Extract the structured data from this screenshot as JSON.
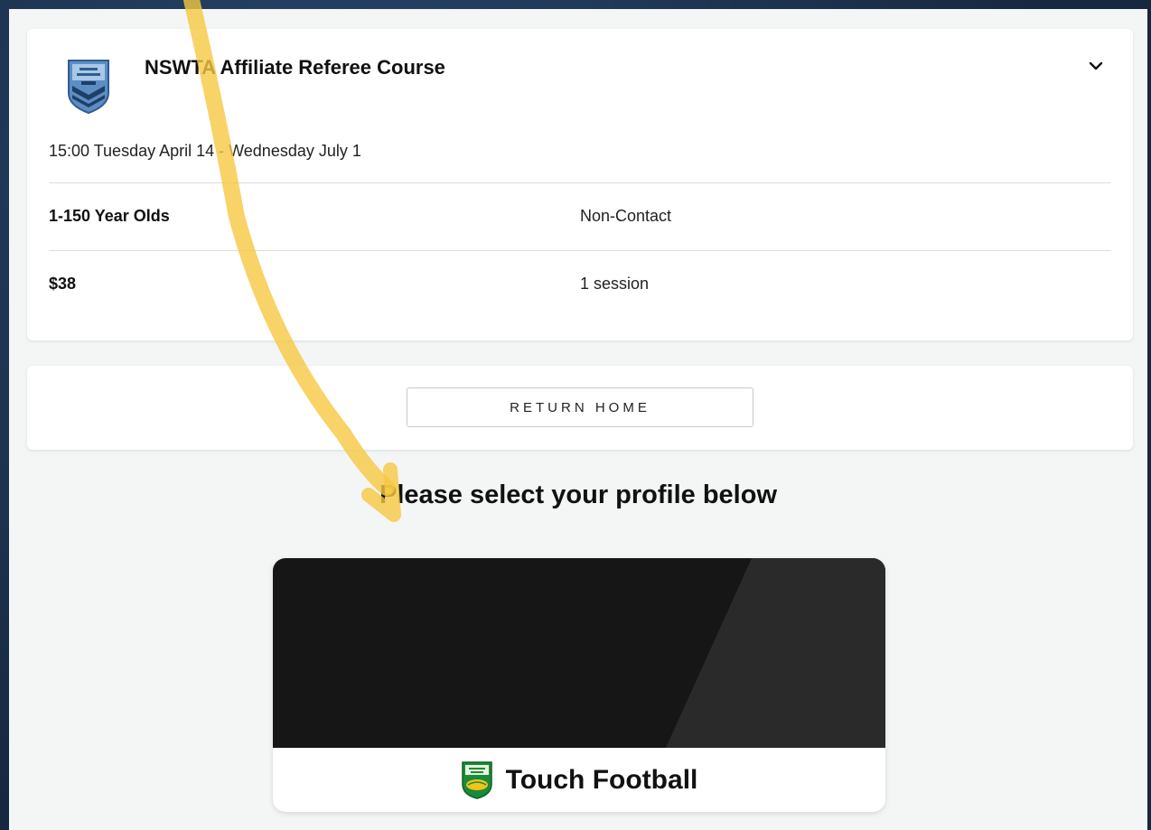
{
  "event": {
    "title": "NSWTA Affiliate Referee Course",
    "logo_icon": "nsw-touch-football-shield-icon",
    "date": "15:00 Tuesday April 14 - Wednesday July 1",
    "age_range": "1-150 Year Olds",
    "contact_type": "Non-Contact",
    "price": "$38",
    "sessions": "1 session",
    "expand_icon": "chevron-down-icon"
  },
  "actions": {
    "return_home_label": "RETURN HOME"
  },
  "profile_section": {
    "heading": "Please select your profile below",
    "profiles": [
      {
        "name": "Touch Football",
        "logo_icon": "touch-football-shield-icon"
      }
    ]
  },
  "colors": {
    "annotation_arrow": "#f5c842",
    "banner_dark": "#161616",
    "page_background": "#f4f5f5",
    "outer_background": "#1e3552"
  }
}
